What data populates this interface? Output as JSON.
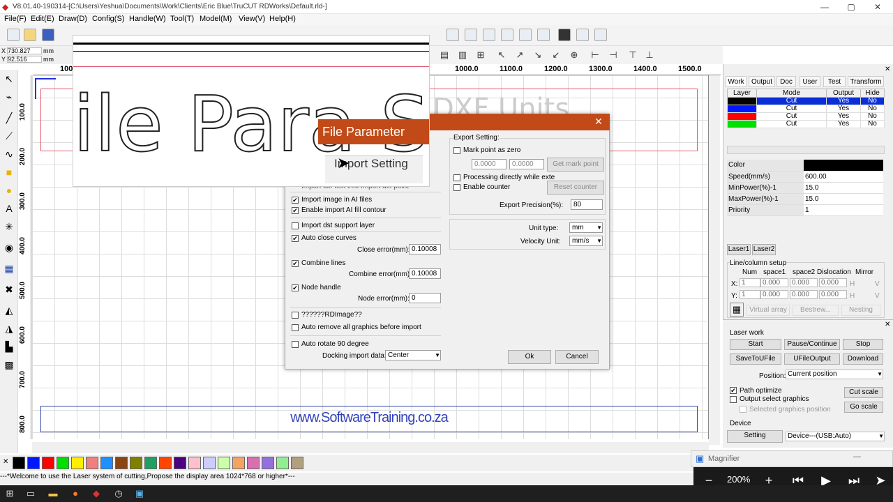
{
  "window": {
    "title": "V8.01.40-190314-[C:\\Users\\Yeshua\\Documents\\Work\\Clients\\Eric Blue\\TruCUT RDWorks\\Default.rld-]"
  },
  "menu": [
    "File(F)",
    "Edit(E)",
    "Draw(D)",
    "Config(S)",
    "Handle(W)",
    "Tool(T)",
    "Model(M)",
    "View(V)",
    "Help(H)"
  ],
  "coords": {
    "x_label": "X",
    "x_value": "730.827",
    "y_label": "Y",
    "y_value": "92.516",
    "unit": "mm"
  },
  "ruler_h": [
    "1000.0",
    "1100.0",
    "1200.0",
    "1300.0",
    "1400.0",
    "1500.0",
    "100"
  ],
  "ruler_v": [
    "100.0",
    "200.0",
    "300.0",
    "400.0",
    "500.0",
    "600.0",
    "700.0",
    "800.0"
  ],
  "canvas": {
    "website": "www.SoftwareTraining.co.za",
    "ghost_text": "DXF Units",
    "magnified_text": "ile Para  Setti"
  },
  "dialog": {
    "title": "File Parameter",
    "import_setting_label": "Import Setting",
    "partial_row": "Import dxf text info     Import dxf point",
    "options": [
      {
        "label": "Import image in AI files",
        "checked": true
      },
      {
        "label": "Enable import AI fill contour",
        "checked": true
      },
      {
        "label": "Import dst support layer",
        "checked": false
      },
      {
        "label": "Auto close curves",
        "checked": true
      },
      {
        "label": "Combine lines",
        "checked": true
      },
      {
        "label": "Node handle",
        "checked": true
      },
      {
        "label": "??????RDImage??",
        "checked": false
      },
      {
        "label": "Auto remove all graphics before import",
        "checked": false
      },
      {
        "label": "Auto rotate 90 degree",
        "checked": false
      }
    ],
    "close_error_label": "Close error(mm):",
    "close_error_value": "0.10008",
    "combine_error_label": "Combine error(mm):",
    "combine_error_value": "0.10008",
    "node_error_label": "Node error(mm):",
    "node_error_value": "0",
    "docking_label": "Docking import data:",
    "docking_value": "Center",
    "export": {
      "group_label": "Export Setting:",
      "mark_point_label": "Mark point as zero",
      "x_value": "0.0000",
      "y_value": "0.0000",
      "get_mark_point": "Get mark point",
      "processing_label": "Processing directly while exte",
      "counter_label": "Enable counter",
      "reset_counter": "Reset counter",
      "precision_label": "Export Precision(%):",
      "precision_value": "80"
    },
    "unit_type_label": "Unit type:",
    "unit_type_value": "mm",
    "velocity_label": "Velocity Unit:",
    "velocity_value": "mm/s",
    "ok": "Ok",
    "cancel": "Cancel"
  },
  "right_panel": {
    "tabs": [
      "Work",
      "Output",
      "Doc",
      "User",
      "Test",
      "Transform"
    ],
    "layer_headers": [
      "Layer",
      "Mode",
      "Output",
      "Hide"
    ],
    "layers": [
      {
        "color": "#000000",
        "mode": "Cut",
        "output": "Yes",
        "hide": "No"
      },
      {
        "color": "#0018ff",
        "mode": "Cut",
        "output": "Yes",
        "hide": "No"
      },
      {
        "color": "#ff0000",
        "mode": "Cut",
        "output": "Yes",
        "hide": "No"
      },
      {
        "color": "#00e000",
        "mode": "Cut",
        "output": "Yes",
        "hide": "No"
      }
    ],
    "params": [
      {
        "k": "Color",
        "v": ""
      },
      {
        "k": "Speed(mm/s)",
        "v": "600.00"
      },
      {
        "k": "MinPower(%)-1",
        "v": "15.0"
      },
      {
        "k": "MaxPower(%)-1",
        "v": "15.0"
      },
      {
        "k": "Priority",
        "v": "1"
      }
    ],
    "laser_tabs": [
      "Laser1",
      "Laser2"
    ],
    "array": {
      "title": "Line/column setup",
      "headers": [
        "Num",
        "space1",
        "space2",
        "Dislocation",
        "Mirror"
      ],
      "x_label": "X:",
      "y_label": "Y:",
      "num": "1",
      "val": "0.000",
      "h": "H",
      "v": "V",
      "virtual_array": "Virtual array",
      "bestrew": "Bestrew...",
      "nesting": "Nesting"
    }
  },
  "laser_work": {
    "title": "Laser work",
    "buttons": [
      "Start",
      "Pause/Continue",
      "Stop",
      "SaveToUFile",
      "UFileOutput",
      "Download"
    ],
    "position_label": "Position:",
    "position_value": "Current position",
    "path_opt": "Path optimize",
    "output_select": "Output select graphics",
    "selected_graphics": "Selected graphics position",
    "cut_scale": "Cut scale",
    "go_scale": "Go scale",
    "device_title": "Device",
    "setting": "Setting",
    "device_value": "Device---(USB:Auto)"
  },
  "palette": [
    "#000000",
    "#0018ff",
    "#ff0000",
    "#00e000",
    "#ffee00",
    "#f08080",
    "#1e90ff",
    "#8b4513",
    "#808000",
    "#20a060",
    "#ff4500",
    "#4b0082",
    "#ffc0cb",
    "#ccccff",
    "#ccffaa",
    "#f4a460",
    "#d870b0",
    "#9370db",
    "#90ee90",
    "#b0a080"
  ],
  "status": "---*Welcome to use the Laser system of cutting,Propose the display area 1024*768 or higher*---",
  "magnifier": {
    "title": "Magnifier",
    "zoom": "200%"
  }
}
